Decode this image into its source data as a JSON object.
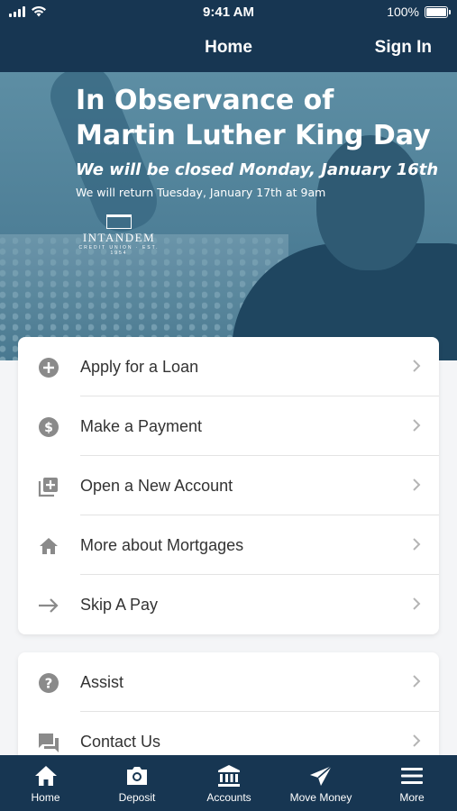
{
  "status_bar": {
    "time": "9:41 AM",
    "battery": "100%"
  },
  "nav": {
    "title": "Home",
    "sign_in": "Sign In"
  },
  "banner": {
    "headline_line1": "In Observance of",
    "headline_line2": "Martin Luther King Day",
    "closed_text": "We will be closed Monday, January 16th",
    "return_text": "We will return Tuesday, January 17th at 9am",
    "logo_name": "INTANDEM",
    "logo_sub": "CREDIT UNION · EST. 1954"
  },
  "actions": [
    {
      "label": "Apply for a Loan",
      "icon": "plus-circle-icon"
    },
    {
      "label": "Make a Payment",
      "icon": "dollar-circle-icon"
    },
    {
      "label": "Open a New Account",
      "icon": "add-box-icon"
    },
    {
      "label": "More about Mortgages",
      "icon": "home-icon"
    },
    {
      "label": "Skip A Pay",
      "icon": "arrow-right-icon"
    }
  ],
  "support": [
    {
      "label": "Assist",
      "icon": "question-circle-icon"
    },
    {
      "label": "Contact Us",
      "icon": "chat-icon"
    }
  ],
  "tabs": [
    {
      "label": "Home",
      "icon": "home-icon"
    },
    {
      "label": "Deposit",
      "icon": "camera-icon"
    },
    {
      "label": "Accounts",
      "icon": "bank-icon"
    },
    {
      "label": "Move Money",
      "icon": "send-icon"
    },
    {
      "label": "More",
      "icon": "menu-icon"
    }
  ],
  "colors": {
    "navy": "#173652",
    "icon_gray": "#8a8a8a",
    "text": "#333333"
  }
}
